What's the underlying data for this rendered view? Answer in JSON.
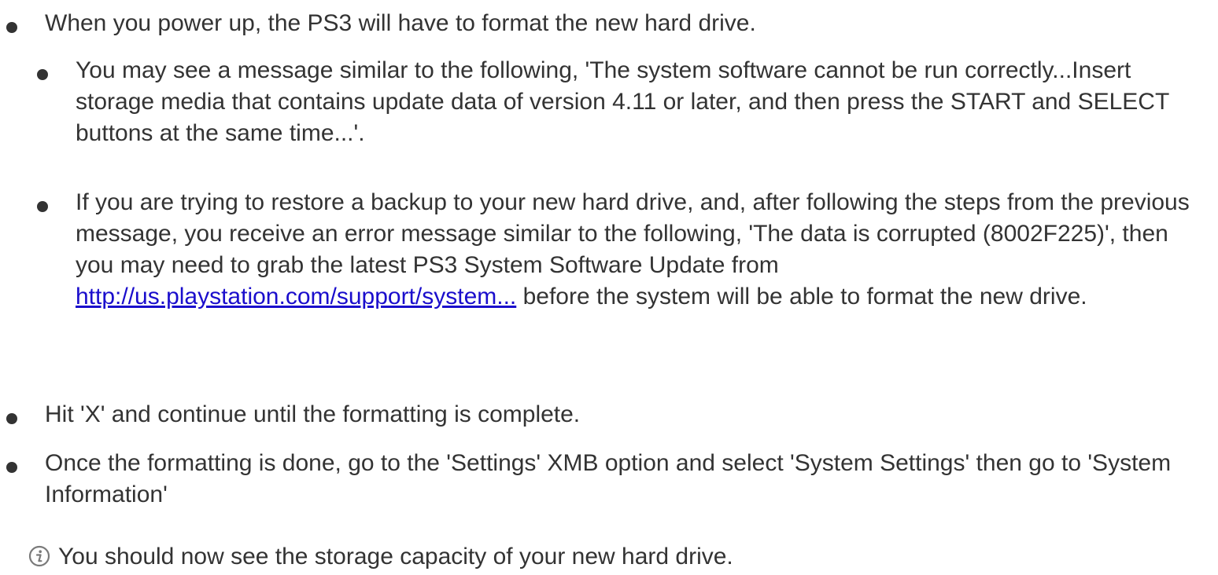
{
  "items": [
    {
      "level": 1,
      "text": "When you power up, the PS3 will have to format the new hard drive."
    },
    {
      "level": 2,
      "text": "You may see a message similar to the following, 'The system software cannot be run correctly...Insert storage media that contains update data of version 4.11 or later, and then press the START and SELECT buttons at the same time...'."
    },
    {
      "level": 2,
      "text_before": "If you are trying to restore a backup to your new hard drive, and, after following the steps from the previous message, you receive an error message similar to the following, 'The data is corrupted (8002F225)', then you may need to grab the latest PS3 System Software Update from ",
      "link_text": "http://us.playstation.com/support/system...",
      "text_after": " before the system will be able to format the new drive."
    },
    {
      "level": 1,
      "text": "Hit 'X' and continue until the formatting is complete."
    },
    {
      "level": 1,
      "text": "Once the formatting is done, go to the 'Settings' XMB option and select 'System Settings' then go to 'System Information'"
    },
    {
      "level": 1,
      "icon": "info-icon",
      "text": "You should now see the storage capacity of your new hard drive."
    }
  ],
  "colors": {
    "text": "#333333",
    "link": "#1a0dcc"
  }
}
